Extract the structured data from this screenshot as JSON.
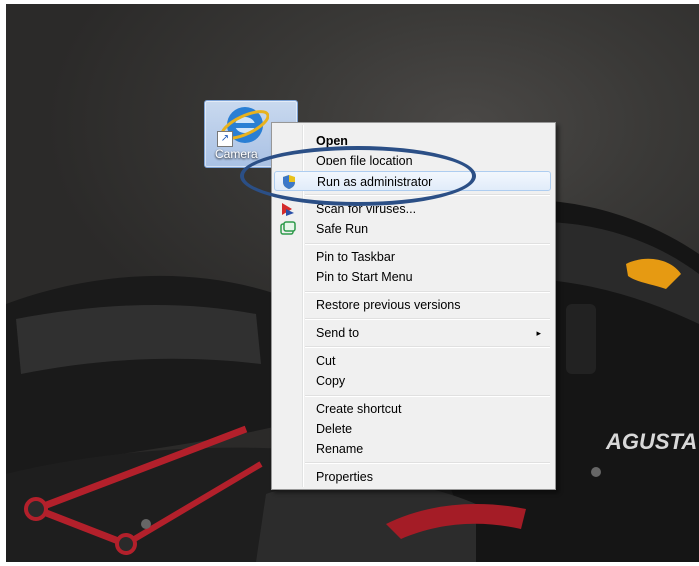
{
  "desktop": {
    "icon_label": "Camera",
    "icon_name": "internet-explorer-icon",
    "wallpaper_text": "AGUSTA"
  },
  "context_menu": {
    "items": [
      {
        "label": "Open",
        "bold": true
      },
      {
        "label": "Open file location"
      },
      {
        "label": "Run as administrator",
        "icon": "uac-shield-icon",
        "highlighted": true
      },
      {
        "label": "Scan for viruses...",
        "icon": "antivirus-icon"
      },
      {
        "label": "Safe Run",
        "icon": "safe-run-icon"
      },
      {
        "label": "Pin to Taskbar"
      },
      {
        "label": "Pin to Start Menu"
      },
      {
        "label": "Restore previous versions"
      },
      {
        "label": "Send to",
        "submenu": true
      },
      {
        "label": "Cut"
      },
      {
        "label": "Copy"
      },
      {
        "label": "Create shortcut"
      },
      {
        "label": "Delete"
      },
      {
        "label": "Rename"
      },
      {
        "label": "Properties"
      }
    ],
    "submenu_arrow": "▸"
  },
  "colors": {
    "annotation_ring": "#2b4f86",
    "menu_background": "#f0f0f0",
    "hover_border": "#aecdf0"
  }
}
